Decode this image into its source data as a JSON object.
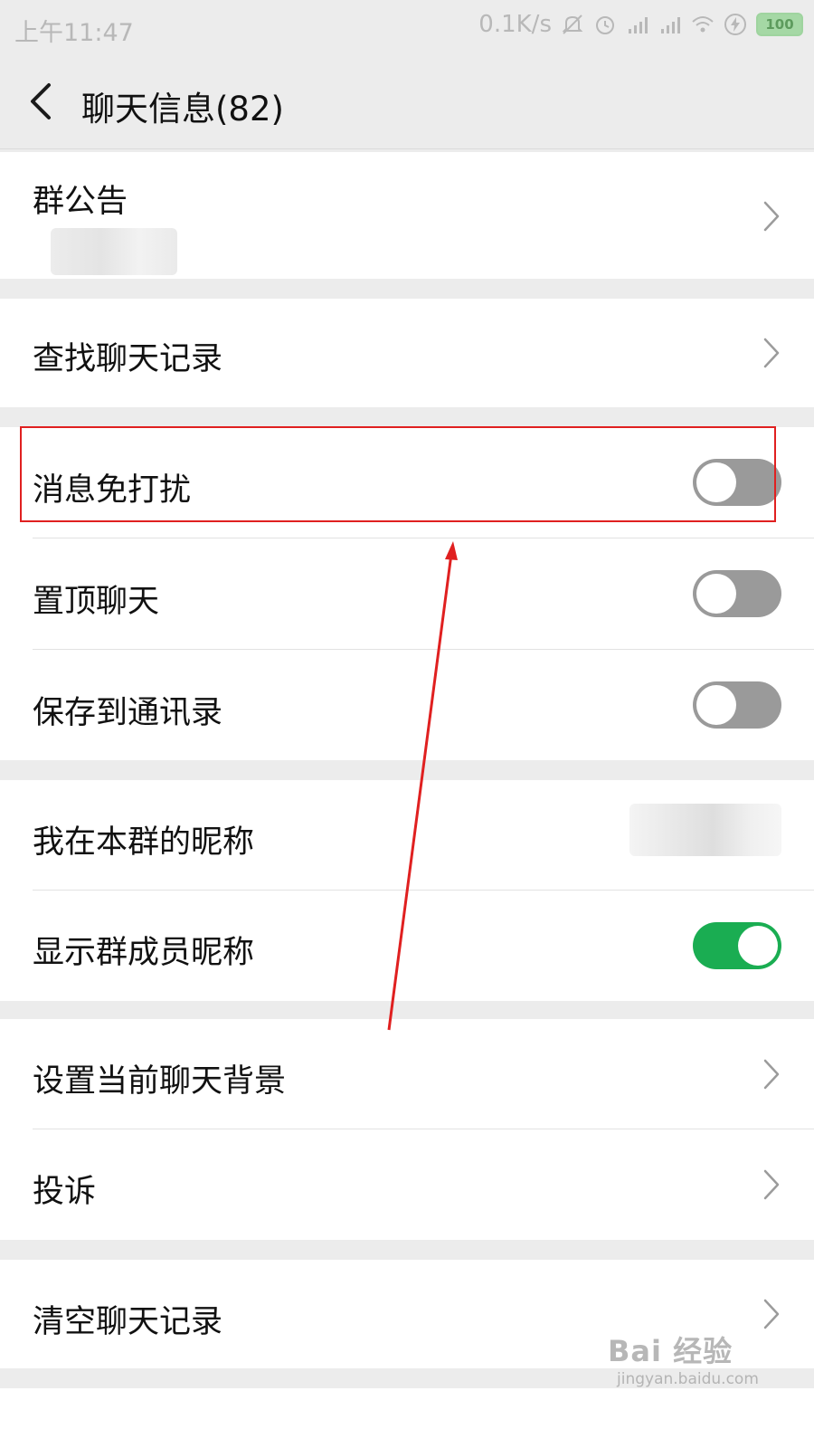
{
  "status_bar": {
    "time": "上午11:47",
    "speed": "0.1K/s",
    "battery": "100",
    "icons": [
      "mute-icon",
      "alarm-icon",
      "signal-icon",
      "signal-icon",
      "wifi-icon",
      "charging-icon",
      "battery-icon"
    ]
  },
  "header": {
    "back_icon": "back-arrow-icon",
    "title": "聊天信息(82)"
  },
  "announcement": {
    "label": "群公告",
    "chevron": "chevron-right-icon"
  },
  "search_history": {
    "label": "查找聊天记录"
  },
  "toggles": {
    "mute": {
      "label": "消息免打扰",
      "on": false
    },
    "pin": {
      "label": "置顶聊天",
      "on": false
    },
    "save_contacts": {
      "label": "保存到通讯录",
      "on": false
    }
  },
  "nickname": {
    "label": "我在本群的昵称"
  },
  "show_nicknames": {
    "label": "显示群成员昵称",
    "on": true
  },
  "more": {
    "background": {
      "label": "设置当前聊天背景"
    },
    "report": {
      "label": "投诉"
    },
    "clear": {
      "label": "清空聊天记录"
    }
  },
  "watermark": {
    "main": "Bai 经验",
    "sub": "jingyan.baidu.com"
  },
  "colors": {
    "toggle_on": "#1aad52",
    "toggle_off": "#9a9a9a",
    "annotation": "#e02020",
    "page_bg": "#ececec"
  }
}
